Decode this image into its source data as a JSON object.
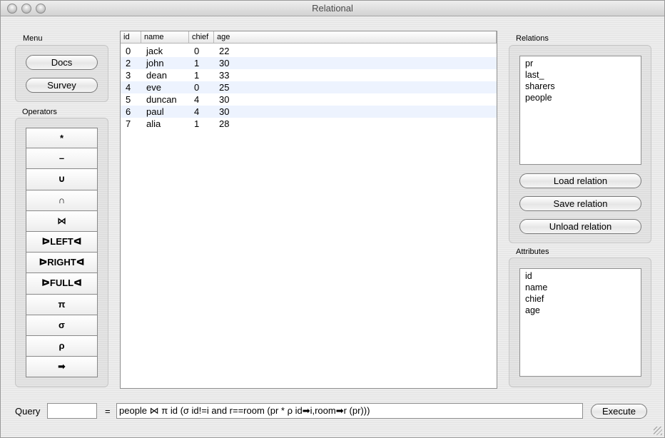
{
  "window": {
    "title": "Relational"
  },
  "menu": {
    "label": "Menu",
    "buttons": [
      "Docs",
      "Survey"
    ]
  },
  "operators": {
    "label": "Operators",
    "buttons": [
      "*",
      "–",
      "∪",
      "∩",
      "⋈",
      "ᐅLEFTᐊ",
      "ᐅRIGHTᐊ",
      "ᐅFULLᐊ",
      "π",
      "σ",
      "ρ",
      "➡"
    ]
  },
  "table": {
    "columns": [
      "id",
      "name",
      "chief",
      "age"
    ],
    "rows": [
      [
        "0",
        "jack",
        "0",
        "22"
      ],
      [
        "2",
        "john",
        "1",
        "30"
      ],
      [
        "3",
        "dean",
        "1",
        "33"
      ],
      [
        "4",
        "eve",
        "0",
        "25"
      ],
      [
        "5",
        "duncan",
        "4",
        "30"
      ],
      [
        "6",
        "paul",
        "4",
        "30"
      ],
      [
        "7",
        "alia",
        "1",
        "28"
      ]
    ]
  },
  "relations": {
    "label": "Relations",
    "items": [
      "pr",
      "last_",
      "sharers",
      "people"
    ],
    "load_label": "Load relation",
    "save_label": "Save relation",
    "unload_label": "Unload relation"
  },
  "attributes": {
    "label": "Attributes",
    "items": [
      "id",
      "name",
      "chief",
      "age"
    ]
  },
  "query": {
    "label": "Query",
    "name_value": "",
    "equals": "=",
    "expression": "people ⋈ π id (σ id!=i and r==room (pr * ρ id➡i,room➡r (pr)))",
    "execute_label": "Execute"
  }
}
